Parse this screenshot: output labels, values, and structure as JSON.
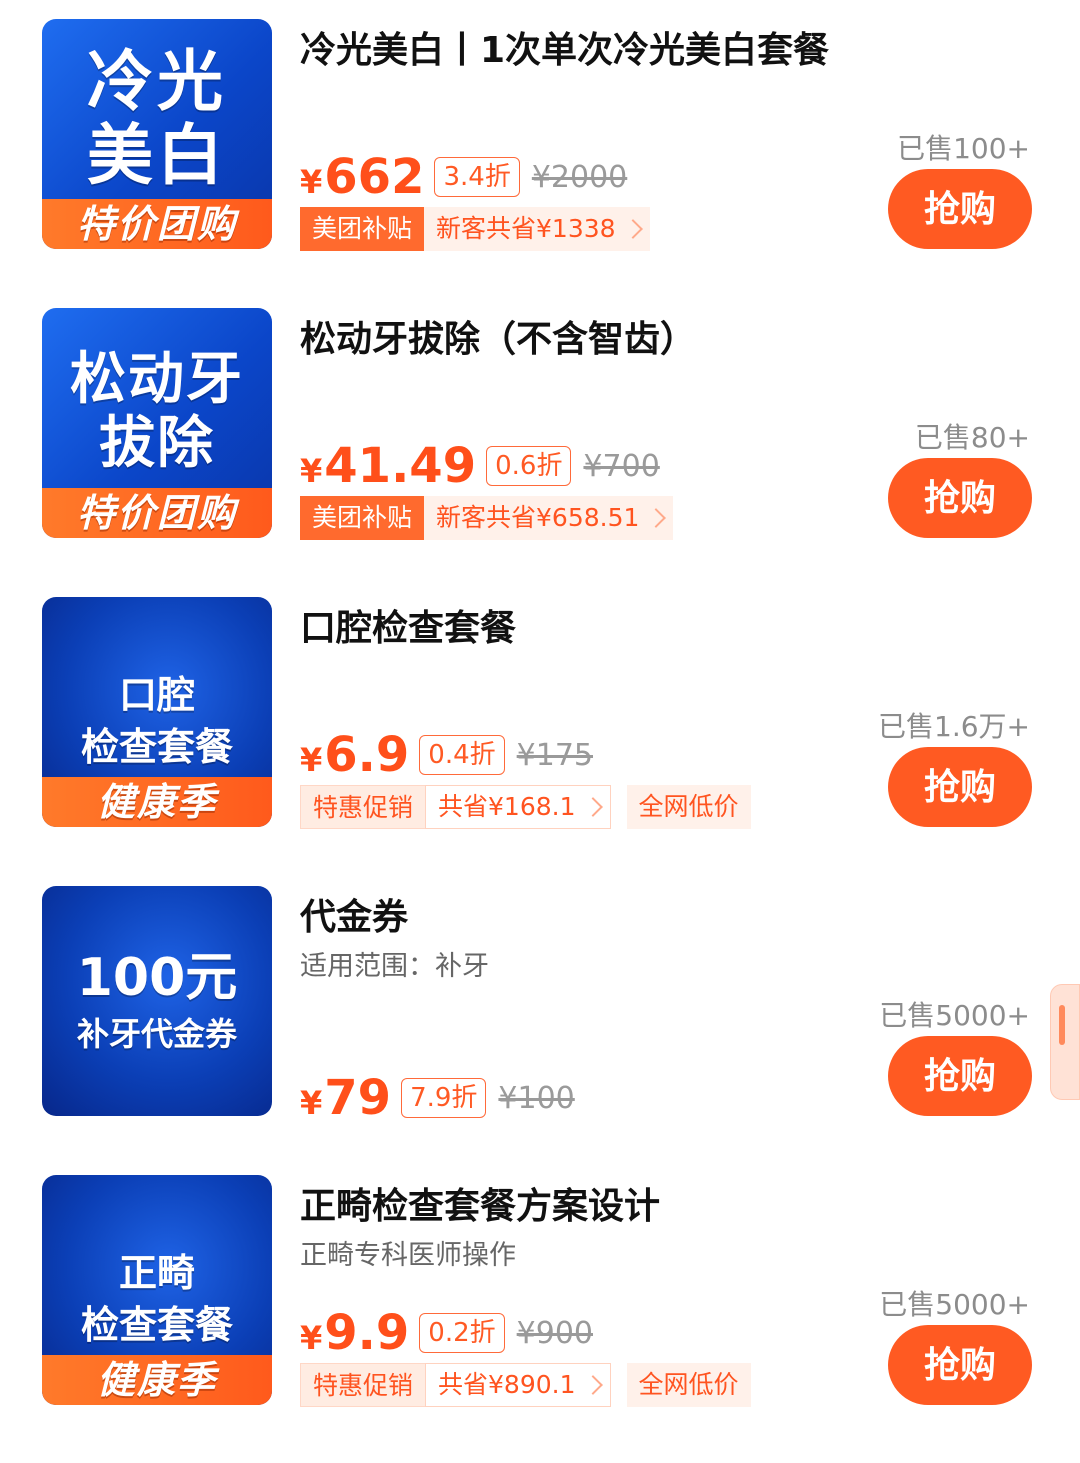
{
  "colors": {
    "accent": "#ff5a22",
    "thumb_blue": "#0b46c9",
    "ribbon_orange": "#ff6a2e"
  },
  "items": [
    {
      "thumb_line1": "冷光",
      "thumb_line2": "美白",
      "ribbon": "特价团购",
      "title": "冷光美白丨1次单次冷光美白套餐",
      "subtitle": "",
      "yen": "¥",
      "price": "662",
      "discount": "3.4折",
      "original": "¥2000",
      "tag_a": "美团补贴",
      "tag_b": "新客共省¥1338",
      "tag_c": "",
      "sold": "已售100+",
      "buy": "抢购"
    },
    {
      "thumb_line1": "松动牙",
      "thumb_line2": "拔除",
      "ribbon": "特价团购",
      "title": "松动牙拔除（不含智齿）",
      "subtitle": "",
      "yen": "¥",
      "price": "41.49",
      "discount": "0.6折",
      "original": "¥700",
      "tag_a": "美团补贴",
      "tag_b": "新客共省¥658.51",
      "tag_c": "",
      "sold": "已售80+",
      "buy": "抢购"
    },
    {
      "thumb_line1": "口腔",
      "thumb_line2": "检查套餐",
      "ribbon": "健康季",
      "title": "口腔检查套餐",
      "subtitle": "",
      "yen": "¥",
      "price": "6.9",
      "discount": "0.4折",
      "original": "¥175",
      "tag_a": "特惠促销",
      "tag_b": "共省¥168.1",
      "tag_c": "全网低价",
      "sold": "已售1.6万+",
      "buy": "抢购"
    },
    {
      "thumb_line1": "100元",
      "thumb_line2": "补牙代金券",
      "ribbon": "",
      "title": "代金券",
      "subtitle": "适用范围：补牙",
      "yen": "¥",
      "price": "79",
      "discount": "7.9折",
      "original": "¥100",
      "tag_a": "",
      "tag_b": "",
      "tag_c": "",
      "sold": "已售5000+",
      "buy": "抢购"
    },
    {
      "thumb_line1": "正畸",
      "thumb_line2": "检查套餐",
      "ribbon": "健康季",
      "title": "正畸检查套餐方案设计",
      "subtitle": "正畸专科医师操作",
      "yen": "¥",
      "price": "9.9",
      "discount": "0.2折",
      "original": "¥900",
      "tag_a": "特惠促销",
      "tag_b": "共省¥890.1",
      "tag_c": "全网低价",
      "sold": "已售5000+",
      "buy": "抢购"
    }
  ]
}
